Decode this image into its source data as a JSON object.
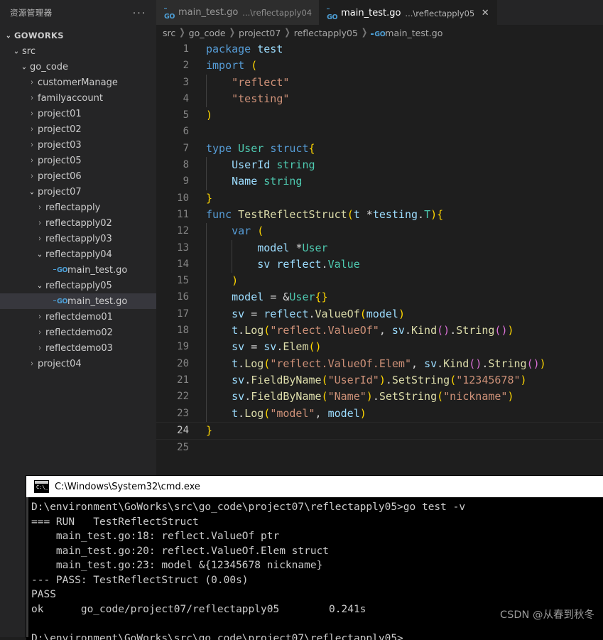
{
  "sidebar": {
    "title": "资源管理器",
    "more_label": "···",
    "tree": [
      {
        "label": "GOWORKS",
        "indent": 0,
        "state": "open",
        "kind": "root"
      },
      {
        "label": "src",
        "indent": 1,
        "state": "open",
        "kind": "folder"
      },
      {
        "label": "go_code",
        "indent": 2,
        "state": "open",
        "kind": "folder"
      },
      {
        "label": "customerManage",
        "indent": 3,
        "state": "closed",
        "kind": "folder"
      },
      {
        "label": "familyaccount",
        "indent": 3,
        "state": "closed",
        "kind": "folder"
      },
      {
        "label": "project01",
        "indent": 3,
        "state": "closed",
        "kind": "folder"
      },
      {
        "label": "project02",
        "indent": 3,
        "state": "closed",
        "kind": "folder"
      },
      {
        "label": "project03",
        "indent": 3,
        "state": "closed",
        "kind": "folder"
      },
      {
        "label": "project05",
        "indent": 3,
        "state": "closed",
        "kind": "folder"
      },
      {
        "label": "project06",
        "indent": 3,
        "state": "closed",
        "kind": "folder"
      },
      {
        "label": "project07",
        "indent": 3,
        "state": "open",
        "kind": "folder"
      },
      {
        "label": "reflectapply",
        "indent": 4,
        "state": "closed",
        "kind": "folder"
      },
      {
        "label": "reflectapply02",
        "indent": 4,
        "state": "closed",
        "kind": "folder"
      },
      {
        "label": "reflectapply03",
        "indent": 4,
        "state": "closed",
        "kind": "folder"
      },
      {
        "label": "reflectapply04",
        "indent": 4,
        "state": "open",
        "kind": "folder"
      },
      {
        "label": "main_test.go",
        "indent": 5,
        "state": "none",
        "kind": "gofile"
      },
      {
        "label": "reflectapply05",
        "indent": 4,
        "state": "open",
        "kind": "folder"
      },
      {
        "label": "main_test.go",
        "indent": 5,
        "state": "none",
        "kind": "gofile",
        "selected": true
      },
      {
        "label": "reflectdemo01",
        "indent": 4,
        "state": "closed",
        "kind": "folder"
      },
      {
        "label": "reflectdemo02",
        "indent": 4,
        "state": "closed",
        "kind": "folder"
      },
      {
        "label": "reflectdemo03",
        "indent": 4,
        "state": "closed",
        "kind": "folder"
      },
      {
        "label": "project04",
        "indent": 3,
        "state": "closed",
        "kind": "folder"
      }
    ]
  },
  "tabs": [
    {
      "name": "main_test.go",
      "desc": "...\\reflectapply04",
      "active": false,
      "icon": "go-file-icon",
      "closable": false
    },
    {
      "name": "main_test.go",
      "desc": "...\\reflectapply05",
      "active": true,
      "icon": "go-file-icon",
      "closable": true,
      "close_label": "✕"
    }
  ],
  "breadcrumb": {
    "separator": "❯",
    "items": [
      "src",
      "go_code",
      "project07",
      "reflectapply05",
      "main_test.go"
    ],
    "last_has_go_icon": true
  },
  "editor": {
    "active_line": 24,
    "total_lines": 25,
    "lines": [
      {
        "n": 1,
        "text": "package test"
      },
      {
        "n": 2,
        "text": "import ("
      },
      {
        "n": 3,
        "text": "    \"reflect\""
      },
      {
        "n": 4,
        "text": "    \"testing\""
      },
      {
        "n": 5,
        "text": ")"
      },
      {
        "n": 6,
        "text": ""
      },
      {
        "n": 7,
        "text": "type User struct{"
      },
      {
        "n": 8,
        "text": "    UserId string"
      },
      {
        "n": 9,
        "text": "    Name string"
      },
      {
        "n": 10,
        "text": "}"
      },
      {
        "n": 11,
        "text": "func TestReflectStruct(t *testing.T){"
      },
      {
        "n": 12,
        "text": "    var ("
      },
      {
        "n": 13,
        "text": "        model *User"
      },
      {
        "n": 14,
        "text": "        sv reflect.Value"
      },
      {
        "n": 15,
        "text": "    )"
      },
      {
        "n": 16,
        "text": "    model = &User{}"
      },
      {
        "n": 17,
        "text": "    sv = reflect.ValueOf(model)"
      },
      {
        "n": 18,
        "text": "    t.Log(\"reflect.ValueOf\", sv.Kind().String())"
      },
      {
        "n": 19,
        "text": "    sv = sv.Elem()"
      },
      {
        "n": 20,
        "text": "    t.Log(\"reflect.ValueOf.Elem\", sv.Kind().String())"
      },
      {
        "n": 21,
        "text": "    sv.FieldByName(\"UserId\").SetString(\"12345678\")"
      },
      {
        "n": 22,
        "text": "    sv.FieldByName(\"Name\").SetString(\"nickname\")"
      },
      {
        "n": 23,
        "text": "    t.Log(\"model\", model)"
      },
      {
        "n": 24,
        "text": "}"
      },
      {
        "n": 25,
        "text": ""
      }
    ]
  },
  "terminal": {
    "title": "C:\\Windows\\System32\\cmd.exe",
    "icon": "cmd-icon",
    "lines": [
      "D:\\environment\\GoWorks\\src\\go_code\\project07\\reflectapply05>go test -v",
      "=== RUN   TestReflectStruct",
      "    main_test.go:18: reflect.ValueOf ptr",
      "    main_test.go:20: reflect.ValueOf.Elem struct",
      "    main_test.go:23: model &{12345678 nickname}",
      "--- PASS: TestReflectStruct (0.00s)",
      "PASS",
      "ok      go_code/project07/reflectapply05        0.241s",
      "",
      "D:\\environment\\GoWorks\\src\\go_code\\project07\\reflectapply05>"
    ]
  },
  "watermark": "CSDN @从春到秋冬",
  "colors": {
    "editor_bg": "#1e1e1e",
    "sidebar_bg": "#252526",
    "tab_inactive_bg": "#2d2d2d",
    "selection_bg": "#37373d",
    "keyword": "#569cd6",
    "string": "#ce9178",
    "type": "#4ec9b0",
    "function": "#dcdcaa",
    "variable": "#9cdcfe",
    "bracket1": "#ffd700",
    "bracket2": "#da70d6",
    "bracket3": "#179fff",
    "linenumber": "#858585",
    "go_icon": "#4d9fd6",
    "terminal_bg": "#000000",
    "terminal_fg": "#cccccc"
  }
}
